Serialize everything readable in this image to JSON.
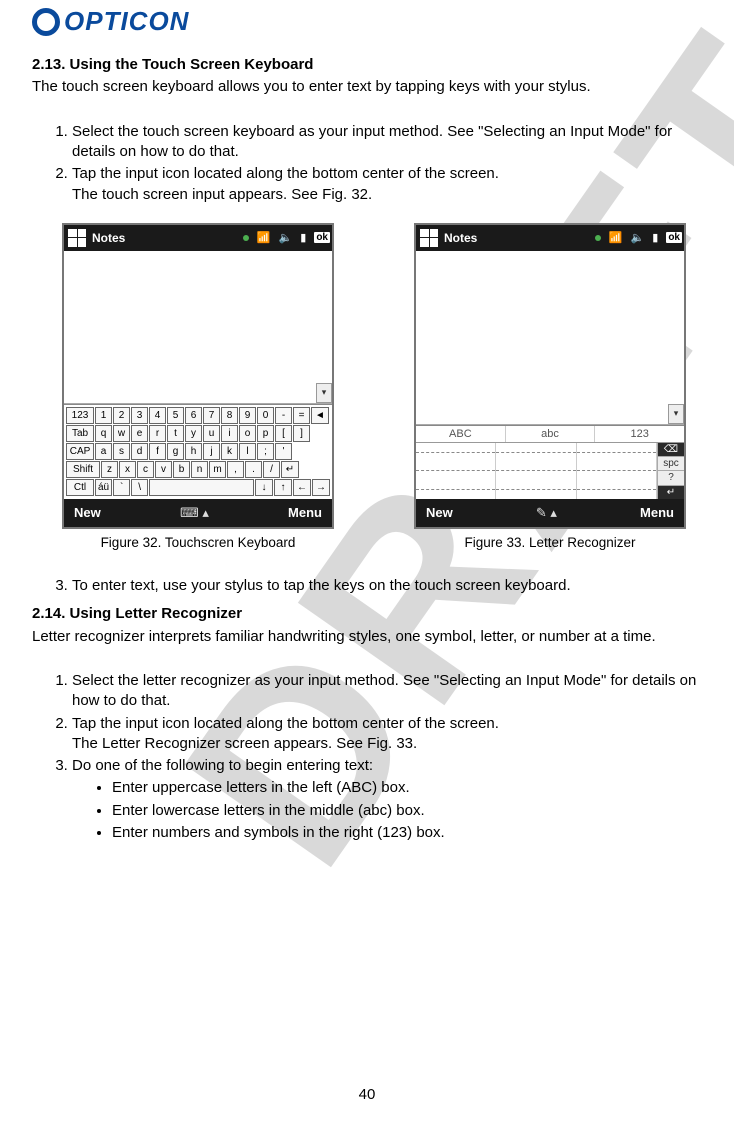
{
  "watermark": "DRAFT",
  "logo": {
    "text": "OPTICON"
  },
  "section213": {
    "title": "2.13. Using the Touch Screen Keyboard",
    "intro": "The touch screen keyboard allows you to enter text by tapping keys with your stylus.",
    "steps": [
      "Select the touch screen keyboard as your input method. See \"Selecting an Input Mode\" for details on how to do that.",
      "Tap the input icon located along the bottom center of the screen.\nThe touch screen input appears. See Fig. 32."
    ],
    "step3": "To enter text, use your stylus to tap the keys on the touch screen keyboard."
  },
  "figures": {
    "f32": {
      "title": "Notes",
      "softkeys": {
        "left": "New",
        "right": "Menu"
      },
      "caption": "Figure 32. Touchscren Keyboard",
      "kbd": {
        "row1": [
          "123",
          "1",
          "2",
          "3",
          "4",
          "5",
          "6",
          "7",
          "8",
          "9",
          "0",
          "-",
          "=",
          "◄"
        ],
        "row2": [
          "Tab",
          "q",
          "w",
          "e",
          "r",
          "t",
          "y",
          "u",
          "i",
          "o",
          "p",
          "[",
          "]"
        ],
        "row3": [
          "CAP",
          "a",
          "s",
          "d",
          "f",
          "g",
          "h",
          "j",
          "k",
          "l",
          ";",
          "'"
        ],
        "row4": [
          "Shift",
          "z",
          "x",
          "c",
          "v",
          "b",
          "n",
          "m",
          ",",
          ".",
          "/",
          "↵"
        ],
        "row5": [
          "Ctl",
          "áü",
          "`",
          "\\",
          " ",
          "↓",
          "↑",
          "←",
          "→"
        ]
      }
    },
    "f33": {
      "title": "Notes",
      "softkeys": {
        "left": "New",
        "right": "Menu"
      },
      "caption": "Figure 33. Letter Recognizer",
      "tabs": {
        "left": "ABC",
        "mid": "abc",
        "right": "123"
      },
      "sideButtons": [
        "⌫",
        "spc",
        "?",
        "↵"
      ]
    }
  },
  "section214": {
    "title": "2.14. Using Letter Recognizer",
    "intro": "Letter recognizer interprets familiar handwriting styles, one symbol, letter, or number at a time.",
    "steps": [
      "Select the letter recognizer as your input method. See \"Selecting an Input Mode\" for details on how to do that.",
      "Tap the input icon located along the bottom center of the screen.\nThe Letter Recognizer screen appears. See Fig. 33.",
      "Do one of the following to begin entering text:"
    ],
    "bullets": [
      "Enter uppercase letters in the left (ABC) box.",
      "Enter lowercase letters in the middle (abc) box.",
      "Enter numbers and symbols in the right (123) box."
    ]
  },
  "pageNumber": "40"
}
